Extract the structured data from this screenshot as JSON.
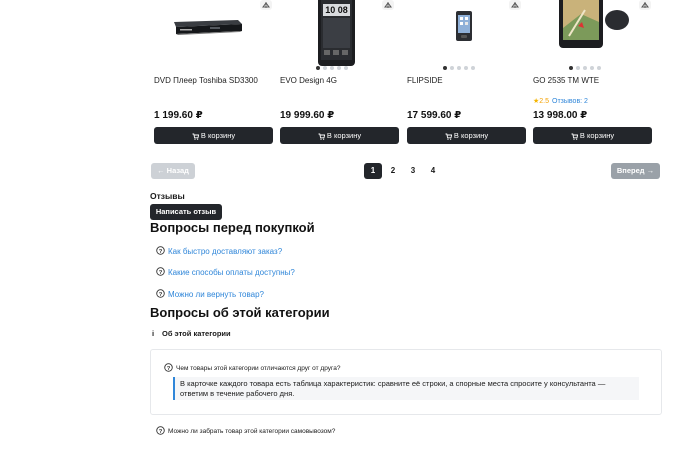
{
  "products": [
    {
      "name": "DVD Плеер Toshiba SD3300",
      "price": "1 199.60 ₽",
      "image_icon": "dvd-player-icon",
      "rating": null
    },
    {
      "name": "EVO Design 4G",
      "price": "19 999.60 ₽",
      "image_icon": "smartphone-icon",
      "rating": null,
      "clock": "10 08"
    },
    {
      "name": "FLIPSIDE",
      "price": "17 599.60 ₽",
      "image_icon": "phone-icon",
      "rating": null
    },
    {
      "name": "GO 2535 TM WTE",
      "price": "13 998.00 ₽",
      "image_icon": "gps-navigator-icon",
      "rating": "2.5",
      "reviews": "Отзывов: 2"
    }
  ],
  "buy_label": "В корзину",
  "pagination": {
    "prev": "← Назад",
    "next": "Вперед →",
    "pages": [
      "1",
      "2",
      "3",
      "4"
    ],
    "current": "1"
  },
  "reviews": {
    "title": "Отзывы",
    "write_button": "Написать отзыв"
  },
  "purchase_questions": {
    "title": "Вопросы перед покупкой",
    "items": [
      "Как быстро доставляют заказ?",
      "Какие способы оплаты доступны?",
      "Можно ли вернуть товар?"
    ]
  },
  "category_questions": {
    "title": "Вопросы об этой категории",
    "about_label": "Об этой категории",
    "faq": [
      {
        "question": "Чем товары этой категории отличаются друг от друга?",
        "answer": "В карточке каждого товара есть таблица характеристик: сравните её строки, а спорные места спросите у консультанта — ответим в течение рабочего дня."
      },
      {
        "question": "Можно ли забрать товар этой категории самовывозом?"
      }
    ]
  },
  "colors": {
    "dark_button": "#23262b",
    "link": "#2f86d9",
    "star": "#f4b400"
  }
}
